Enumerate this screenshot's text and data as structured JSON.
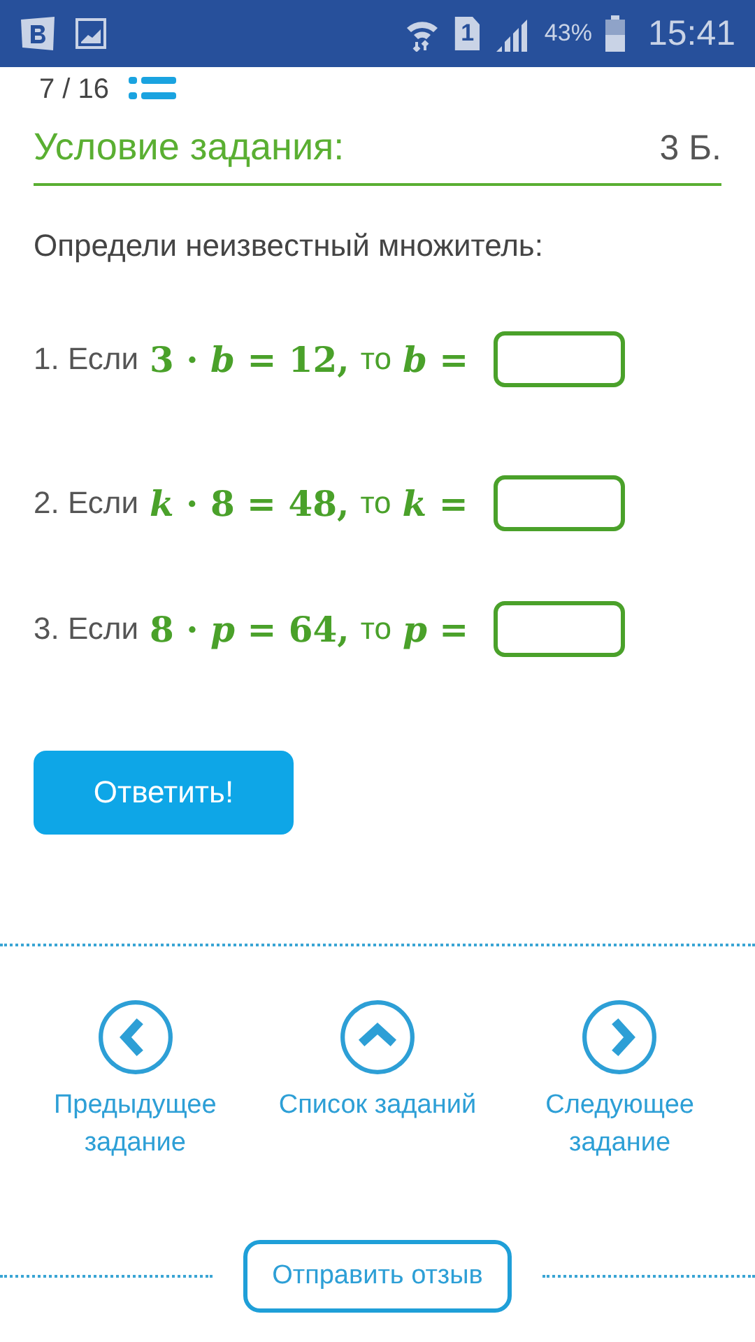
{
  "status_bar": {
    "sim_slot": "1",
    "battery": "43%",
    "time": "15:41"
  },
  "progress": {
    "counter": "7 / 16"
  },
  "task": {
    "title": "Условие задания:",
    "points": "3 Б.",
    "instruction": "Определи неизвестный множитель:",
    "items": [
      {
        "prefix": "1. Если",
        "equation": "3 · *b* = 12,",
        "then": "то",
        "unknown": "*b* ="
      },
      {
        "prefix": "2. Если",
        "equation": "*k* · 8 = 48,",
        "then": "то",
        "unknown": "*k* ="
      },
      {
        "prefix": "3. Если",
        "equation": "8 · *p* = 64,",
        "then": "то",
        "unknown": "*p* ="
      }
    ],
    "submit": "Ответить!"
  },
  "navigation": [
    {
      "kind": "previous",
      "label": "Предыдущее задание"
    },
    {
      "kind": "list",
      "label": "Список заданий"
    },
    {
      "kind": "next",
      "label": "Следующее задание"
    }
  ],
  "feedback": "Отправить отзыв"
}
